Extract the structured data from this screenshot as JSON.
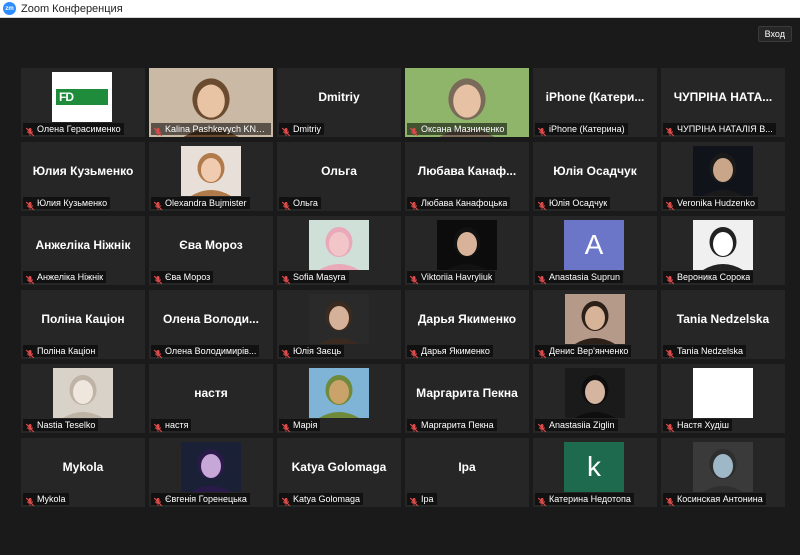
{
  "app": {
    "title": "Zoom Конференция",
    "logo_text": "zm",
    "exit_label": "Вход"
  },
  "colors": {
    "active_speaker": "#a8e54a",
    "tile_bg": "#262626",
    "mic_muted": "#e04a4a"
  },
  "participants": [
    {
      "display": "logo",
      "logo_text": "FD",
      "name": "Олена Герасименко"
    },
    {
      "display": "photo",
      "name": "Kalina Pashkevych KNUT..."
    },
    {
      "display": "Dmitriy",
      "name": "Dmitriy"
    },
    {
      "display": "photo",
      "name": "Оксана Мазниченко",
      "active": true
    },
    {
      "display": "iPhone  (Катери...",
      "name": "iPhone (Катерина)"
    },
    {
      "display": "ЧУПРІНА  НАТА...",
      "name": "ЧУПРІНА НАТАЛІЯ В..."
    },
    {
      "display": "Юлия Кузьменко",
      "name": "Юлия Кузьменко"
    },
    {
      "display": "photo",
      "name": "Olexandra Bujmister"
    },
    {
      "display": "Ольга",
      "name": "Ольга"
    },
    {
      "display": "Любава  Канаф...",
      "name": "Любава Канафоцька"
    },
    {
      "display": "Юлія Осадчук",
      "name": "Юлія Осадчук"
    },
    {
      "display": "photo",
      "name": "Veronika Hudzenko"
    },
    {
      "display": "Анжеліка Ніжнік",
      "name": "Анжеліка Ніжнік"
    },
    {
      "display": "Єва Мороз",
      "name": "Єва Мороз"
    },
    {
      "display": "photo",
      "name": "Sofia Masyra"
    },
    {
      "display": "photo",
      "name": "Viktoriia Havryliuk"
    },
    {
      "display": "letter",
      "letter": "A",
      "name": "Anastasia Suprun"
    },
    {
      "display": "photo",
      "name": "Вероника Сорока"
    },
    {
      "display": "Поліна Каціон",
      "name": "Поліна Каціон"
    },
    {
      "display": "Олена  Володи...",
      "name": "Олена Володимирів..."
    },
    {
      "display": "photo",
      "name": "Юлія Заєць"
    },
    {
      "display": "Дарья Якименко",
      "name": "Дарья Якименко"
    },
    {
      "display": "photo",
      "name": "Денис Вер'янченко"
    },
    {
      "display": "Tania Nedzelska",
      "name": "Tania Nedzelska"
    },
    {
      "display": "photo",
      "name": "Nastia Teselko"
    },
    {
      "display": "настя",
      "name": "настя"
    },
    {
      "display": "photo",
      "name": "Марія"
    },
    {
      "display": "Маргарита Пекна",
      "name": "Маргарита Пекна"
    },
    {
      "display": "photo",
      "name": "Anastasiia Ziglin"
    },
    {
      "display": "photo",
      "name": "Настя Худіш"
    },
    {
      "display": "Mykola",
      "name": "Mykola"
    },
    {
      "display": "photo",
      "name": "Євгенія Горенецька"
    },
    {
      "display": "Katya Golomaga",
      "name": "Katya Golomaga"
    },
    {
      "display": "Іра",
      "name": "Іра"
    },
    {
      "display": "letter",
      "letter": "k",
      "name": "Катерина Недотопа"
    },
    {
      "display": "photo",
      "name": "Косинская Антонина"
    }
  ]
}
